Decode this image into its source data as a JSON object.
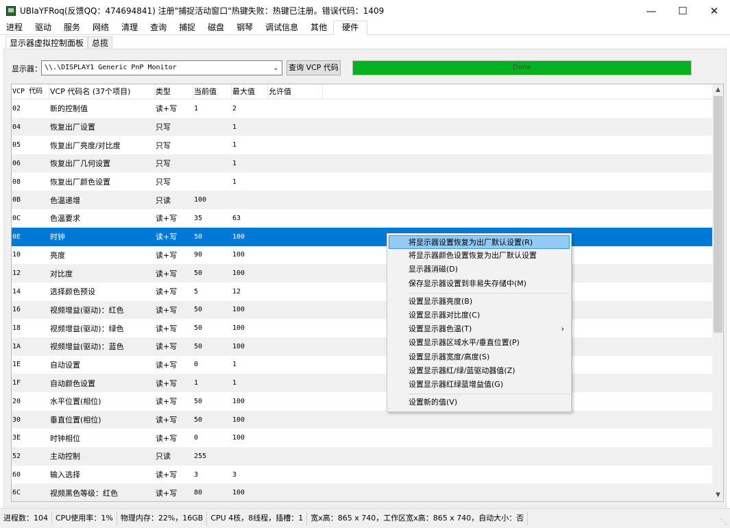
{
  "window": {
    "title": "UBIaYFRoq(反馈QQ：474694841) 注册\"捕捉活动窗口\"热键失败：热键已注册。错误代码：1409",
    "minimize": "—",
    "maximize": "☐",
    "close": "✕"
  },
  "main_tabs": [
    "进程",
    "驱动",
    "服务",
    "网络",
    "清理",
    "查询",
    "捕捉",
    "磁盘",
    "钢琴",
    "调试信息",
    "其他",
    "硬件"
  ],
  "active_main_tab": "硬件",
  "sub_tabs": [
    "显示器虚拟控制面板",
    "总揽"
  ],
  "monitor": {
    "label": "显示器：",
    "selected": "\\\\.\\DISPLAY1 Generic PnP Monitor",
    "query_button": "查询 VCP 代码",
    "progress_text": "Done",
    "progress_value": 1.0,
    "progress_color": "#06b025"
  },
  "table": {
    "headers": [
      "VCP 代码",
      "VCP 代码名 (37个项目)",
      "类型",
      "当前值",
      "最大值",
      "允许值"
    ],
    "rows": [
      [
        "02",
        "新的控制值",
        "读+写",
        "1",
        "2",
        ""
      ],
      [
        "04",
        "恢复出厂设置",
        "只写",
        "",
        "1",
        ""
      ],
      [
        "05",
        "恢复出厂亮度/对比度",
        "只写",
        "",
        "1",
        ""
      ],
      [
        "06",
        "恢复出厂几何设置",
        "只写",
        "",
        "1",
        ""
      ],
      [
        "08",
        "恢复出厂颜色设置",
        "只写",
        "",
        "1",
        ""
      ],
      [
        "0B",
        "色温递增",
        "只读",
        "100",
        "",
        ""
      ],
      [
        "0C",
        "色温要求",
        "读+写",
        "35",
        "63",
        ""
      ],
      [
        "0E",
        "时钟",
        "读+写",
        "50",
        "100",
        ""
      ],
      [
        "10",
        "亮度",
        "读+写",
        "90",
        "100",
        ""
      ],
      [
        "12",
        "对比度",
        "读+写",
        "50",
        "100",
        ""
      ],
      [
        "14",
        "选择颜色预设",
        "读+写",
        "5",
        "12",
        ""
      ],
      [
        "16",
        "视频增益(驱动)：红色",
        "读+写",
        "50",
        "100",
        ""
      ],
      [
        "18",
        "视频增益(驱动)：绿色",
        "读+写",
        "50",
        "100",
        ""
      ],
      [
        "1A",
        "视频增益(驱动)：蓝色",
        "读+写",
        "50",
        "100",
        ""
      ],
      [
        "1E",
        "自动设置",
        "读+写",
        "0",
        "1",
        ""
      ],
      [
        "1F",
        "自动颜色设置",
        "读+写",
        "1",
        "1",
        ""
      ],
      [
        "20",
        "水平位置(相位)",
        "读+写",
        "50",
        "100",
        ""
      ],
      [
        "30",
        "垂直位置(相位)",
        "读+写",
        "50",
        "100",
        ""
      ],
      [
        "3E",
        "时钟相位",
        "读+写",
        "0",
        "100",
        ""
      ],
      [
        "52",
        "主动控制",
        "只读",
        "255",
        "",
        ""
      ],
      [
        "60",
        "输入选择",
        "读+写",
        "3",
        "3",
        ""
      ],
      [
        "6C",
        "视频黑色等级：红色",
        "读+写",
        "80",
        "100",
        ""
      ]
    ],
    "selected_row": "0E"
  },
  "context_menu": [
    {
      "label": "将显示器设置恢复为出厂默认设置(R)",
      "highlighted": true
    },
    {
      "label": "将显示器颜色设置恢复为出厂默认设置"
    },
    {
      "label": "显示器消磁(D)"
    },
    {
      "label": "保存显示器设置到非易失存储中(M)"
    },
    {
      "separator": true
    },
    {
      "label": "设置显示器亮度(B)"
    },
    {
      "label": "设置显示器对比度(C)"
    },
    {
      "label": "设置显示器色温(T)",
      "submenu": true
    },
    {
      "label": "设置显示器区域水平/垂直位置(P)"
    },
    {
      "label": "设置显示器宽度/高度(S)"
    },
    {
      "label": "设置显示器红/绿/蓝驱动器值(Z)"
    },
    {
      "label": "设置显示器红绿蓝增益值(G)"
    },
    {
      "separator": true
    },
    {
      "label": "设置新的值(V)"
    }
  ],
  "statusbar": [
    "进程数：104",
    "CPU使用率：1%",
    "物理内存：22%，16GB",
    "CPU 4核，8线程，插槽：1",
    "宽x高：865 x 740，工作区宽x高：865 x 740，自动大小：否"
  ]
}
